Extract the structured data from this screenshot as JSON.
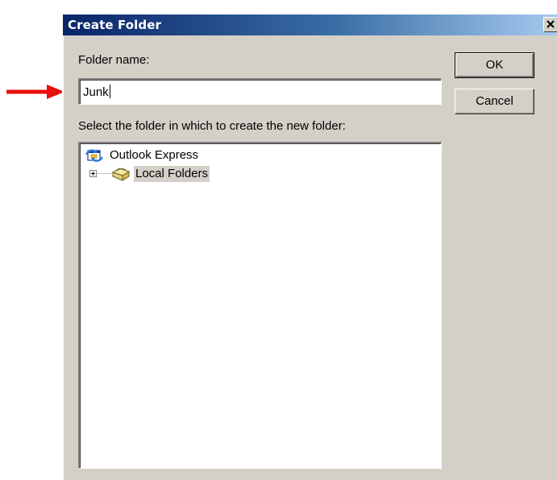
{
  "dialog": {
    "title": "Create Folder",
    "close_icon": "close-icon"
  },
  "form": {
    "folder_name_label": "Folder name:",
    "folder_name_value": "Junk",
    "select_label": "Select the folder in which to create the new folder:"
  },
  "buttons": {
    "ok_label": "OK",
    "cancel_label": "Cancel"
  },
  "tree": {
    "items": [
      {
        "label": "Outlook Express",
        "icon": "outlook-express-icon",
        "level": 0,
        "selected": false
      },
      {
        "label": "Local Folders",
        "icon": "local-folders-icon",
        "level": 1,
        "selected": true,
        "expandable": true
      }
    ]
  },
  "annotation": {
    "arrow_icon": "red-arrow-icon",
    "arrow_color": "#e8100c"
  },
  "colors": {
    "dialog_face": "#d4d0c8",
    "titlebar_start": "#0a246a",
    "titlebar_end": "#a6caf0"
  }
}
